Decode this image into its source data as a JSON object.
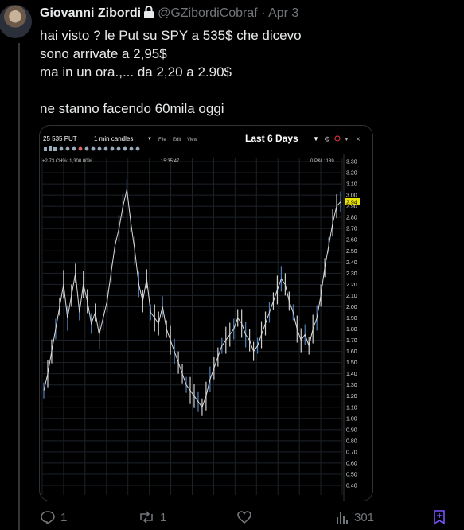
{
  "tweet": {
    "author_name": "Giovanni Zibordi",
    "handle": "@GZibordiCobraf",
    "separator": "·",
    "date": "Apr 3",
    "lines": [
      "hai visto ? le Put su SPY a 535$ che dicevo",
      "sono arrivate a 2,95$",
      "ma in un ora.,... da 2,20 a 2.90$",
      "",
      "ne stanno facendo 60mila oggi"
    ]
  },
  "chart_window": {
    "symbol": "25 535 PUT",
    "interval": "1 min candles",
    "menu": [
      "File",
      "Edit",
      "View"
    ],
    "range": "Last 6 Days",
    "change_text": "+2.73 CH%: 1,300.00%",
    "time_text": "15:35:47",
    "pl_text": "0 P&L: 189",
    "last_price": "2.94"
  },
  "chart_data": {
    "type": "line",
    "title": "",
    "xlabel": "",
    "ylabel": "",
    "ylim": [
      0.4,
      3.3
    ],
    "ytick_labels": [
      "3.30",
      "3.20",
      "3.10",
      "3.00",
      "2.90",
      "2.80",
      "2.70",
      "2.60",
      "2.50",
      "2.40",
      "2.30",
      "2.20",
      "2.10",
      "2.00",
      "1.90",
      "1.80",
      "1.70",
      "1.60",
      "1.50",
      "1.40",
      "1.30",
      "1.20",
      "1.10",
      "1.00",
      "0.90",
      "0.80",
      "0.70",
      "0.60",
      "0.50",
      "0.40"
    ],
    "series": [
      {
        "values": [
          1.25,
          1.4,
          1.6,
          1.8,
          2.0,
          2.2,
          1.9,
          2.1,
          2.3,
          1.95,
          2.2,
          2.05,
          1.85,
          1.95,
          1.75,
          1.9,
          2.05,
          2.3,
          2.55,
          2.7,
          2.9,
          3.05,
          2.75,
          2.5,
          2.2,
          2.05,
          2.25,
          1.95,
          1.9,
          1.85,
          2.0,
          1.8,
          1.7,
          1.6,
          1.5,
          1.4,
          1.3,
          1.25,
          1.2,
          1.15,
          1.1,
          1.2,
          1.35,
          1.45,
          1.55,
          1.65,
          1.7,
          1.75,
          1.8,
          1.9,
          1.85,
          1.75,
          1.7,
          1.6,
          1.65,
          1.75,
          1.85,
          1.95,
          2.05,
          2.15,
          2.25,
          2.2,
          2.05,
          1.95,
          1.8,
          1.7,
          1.75,
          1.65,
          1.8,
          1.9,
          2.1,
          2.35,
          2.55,
          2.75,
          2.9,
          2.94
        ]
      }
    ],
    "last_value": 2.94
  },
  "actions": {
    "reply_count": "1",
    "retweet_count": "1",
    "like_count": "",
    "views_count": "301"
  },
  "colors": {
    "background": "#000000",
    "text": "#e7e9ea",
    "muted": "#71767b",
    "chart_line": "#dcdcdc",
    "price_tag": "#e8e000",
    "bookmark": "#7856ff"
  }
}
